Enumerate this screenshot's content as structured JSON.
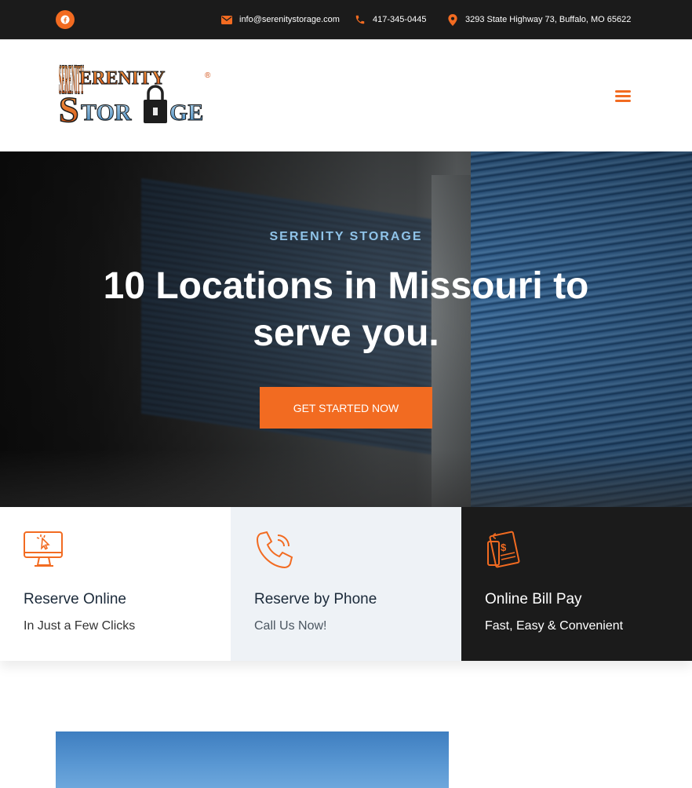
{
  "topbar": {
    "social": "facebook-icon",
    "email": "info@serenitystorage.com",
    "phone": "417-345-0445",
    "address": "3293 State Highway 73, Buffalo, MO 65622"
  },
  "header": {
    "logo_text_1": "SERENITY",
    "logo_text_2": "STOR",
    "logo_text_3": "GE",
    "logo_mark": "®",
    "menu_icon": "hamburger-icon"
  },
  "hero": {
    "eyebrow": "SERENITY STORAGE",
    "title": "10 Locations in Missouri to serve you.",
    "cta": "GET STARTED NOW"
  },
  "features": [
    {
      "icon": "computer-click-icon",
      "title": "Reserve Online",
      "subtitle": "In Just a Few Clicks"
    },
    {
      "icon": "phone-icon",
      "title": "Reserve by Phone",
      "subtitle": "Call Us Now!"
    },
    {
      "icon": "bill-icon",
      "title": "Online Bill Pay",
      "subtitle": "Fast, Easy & Convenient"
    }
  ],
  "colors": {
    "accent": "#f26b21",
    "dark": "#1b1b1b",
    "hero_eyebrow": "#8fc3e8",
    "card_light": "#eef2f6"
  }
}
